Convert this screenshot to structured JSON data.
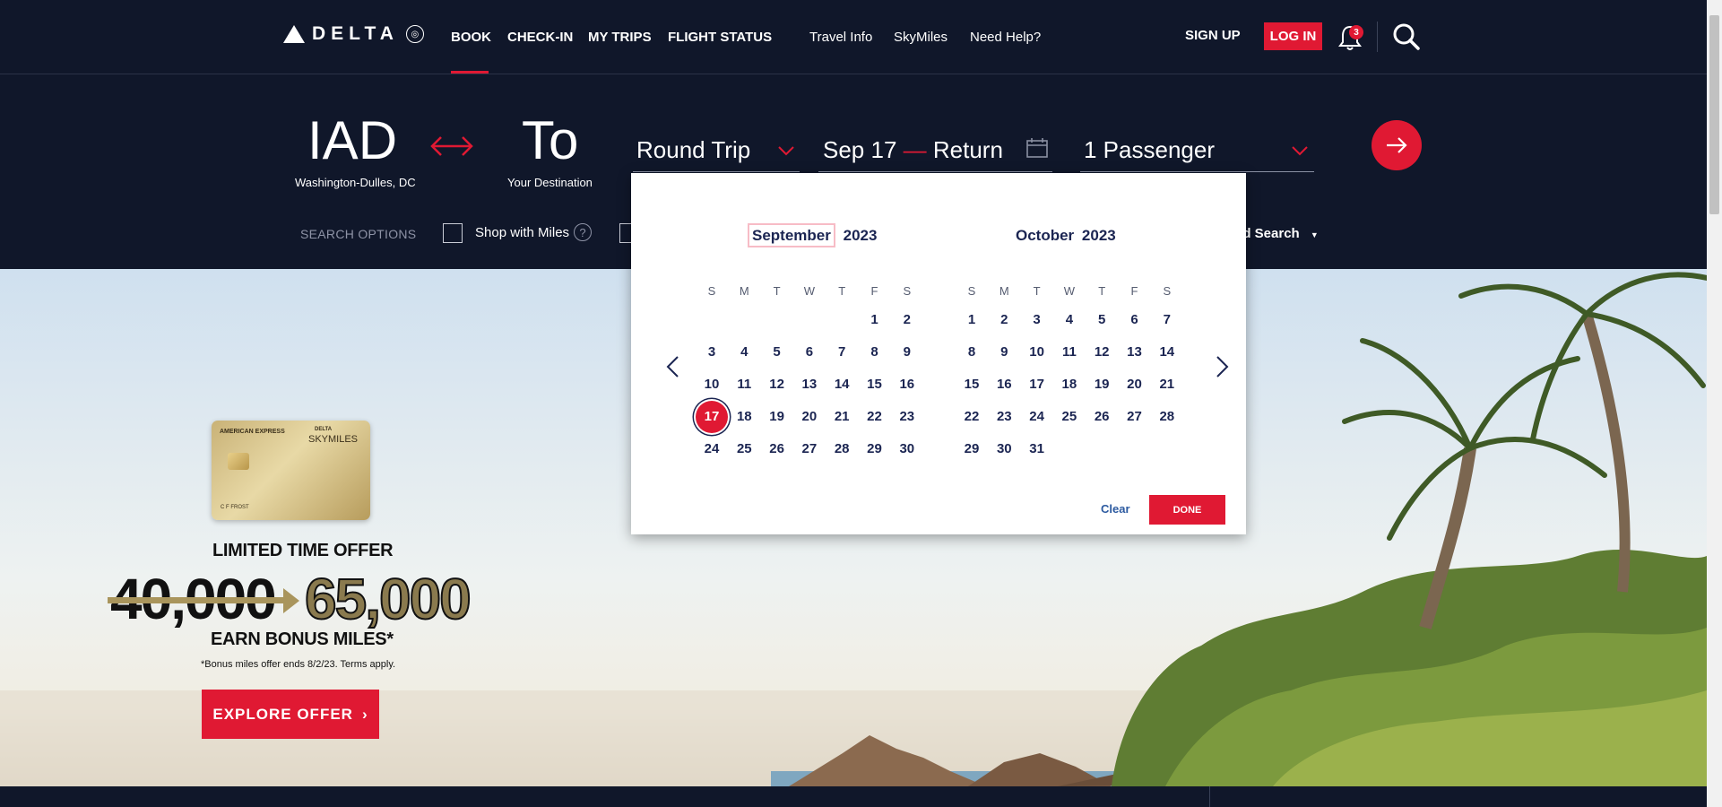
{
  "header": {
    "logo_text": "DELTA",
    "nav_primary": [
      "BOOK",
      "CHECK-IN",
      "MY TRIPS",
      "FLIGHT STATUS"
    ],
    "nav_secondary": [
      "Travel Info",
      "SkyMiles",
      "Need Help?"
    ],
    "signup": "SIGN UP",
    "login": "LOG IN",
    "notification_count": "3"
  },
  "booking": {
    "origin_code": "IAD",
    "origin_name": "Washington-Dulles, DC",
    "destination_code": "To",
    "destination_name": "Your Destination",
    "trip_type": "Round Trip",
    "depart_date": "Sep 17",
    "date_separator": "—",
    "return_label": "Return",
    "passengers": "1 Passenger",
    "search_options_label": "SEARCH OPTIONS",
    "shop_with_miles": "Shop with Miles",
    "help_glyph": "?",
    "advanced_search": "ed Search"
  },
  "calendar": {
    "left_month": "September",
    "left_year": "2023",
    "right_month": "October",
    "right_year": "2023",
    "weekdays": [
      "S",
      "M",
      "T",
      "W",
      "T",
      "F",
      "S"
    ],
    "left_days": [
      [
        "",
        "",
        "",
        "",
        "",
        "1",
        "2"
      ],
      [
        "3",
        "4",
        "5",
        "6",
        "7",
        "8",
        "9"
      ],
      [
        "10",
        "11",
        "12",
        "13",
        "14",
        "15",
        "16"
      ],
      [
        "17",
        "18",
        "19",
        "20",
        "21",
        "22",
        "23"
      ],
      [
        "24",
        "25",
        "26",
        "27",
        "28",
        "29",
        "30"
      ]
    ],
    "right_days": [
      [
        "1",
        "2",
        "3",
        "4",
        "5",
        "6",
        "7"
      ],
      [
        "8",
        "9",
        "10",
        "11",
        "12",
        "13",
        "14"
      ],
      [
        "15",
        "16",
        "17",
        "18",
        "19",
        "20",
        "21"
      ],
      [
        "22",
        "23",
        "24",
        "25",
        "26",
        "27",
        "28"
      ],
      [
        "29",
        "30",
        "31",
        "",
        "",
        "",
        ""
      ]
    ],
    "selected_day": "17",
    "clear": "Clear",
    "done": "DONE"
  },
  "promo": {
    "card_issuer": "AMERICAN EXPRESS",
    "card_brand": "DELTA",
    "card_product": "SKYMILES",
    "card_holder": "C F FROST",
    "title": "LIMITED TIME OFFER",
    "old_miles": "40,000",
    "new_miles": "65,000",
    "earn": "EARN BONUS MILES*",
    "fine_print": "*Bonus miles offer ends 8/2/23. Terms apply.",
    "cta": "EXPLORE OFFER"
  },
  "colors": {
    "navy": "#10172a",
    "brand_red": "#e01933",
    "calendar_text": "#1b2552"
  }
}
